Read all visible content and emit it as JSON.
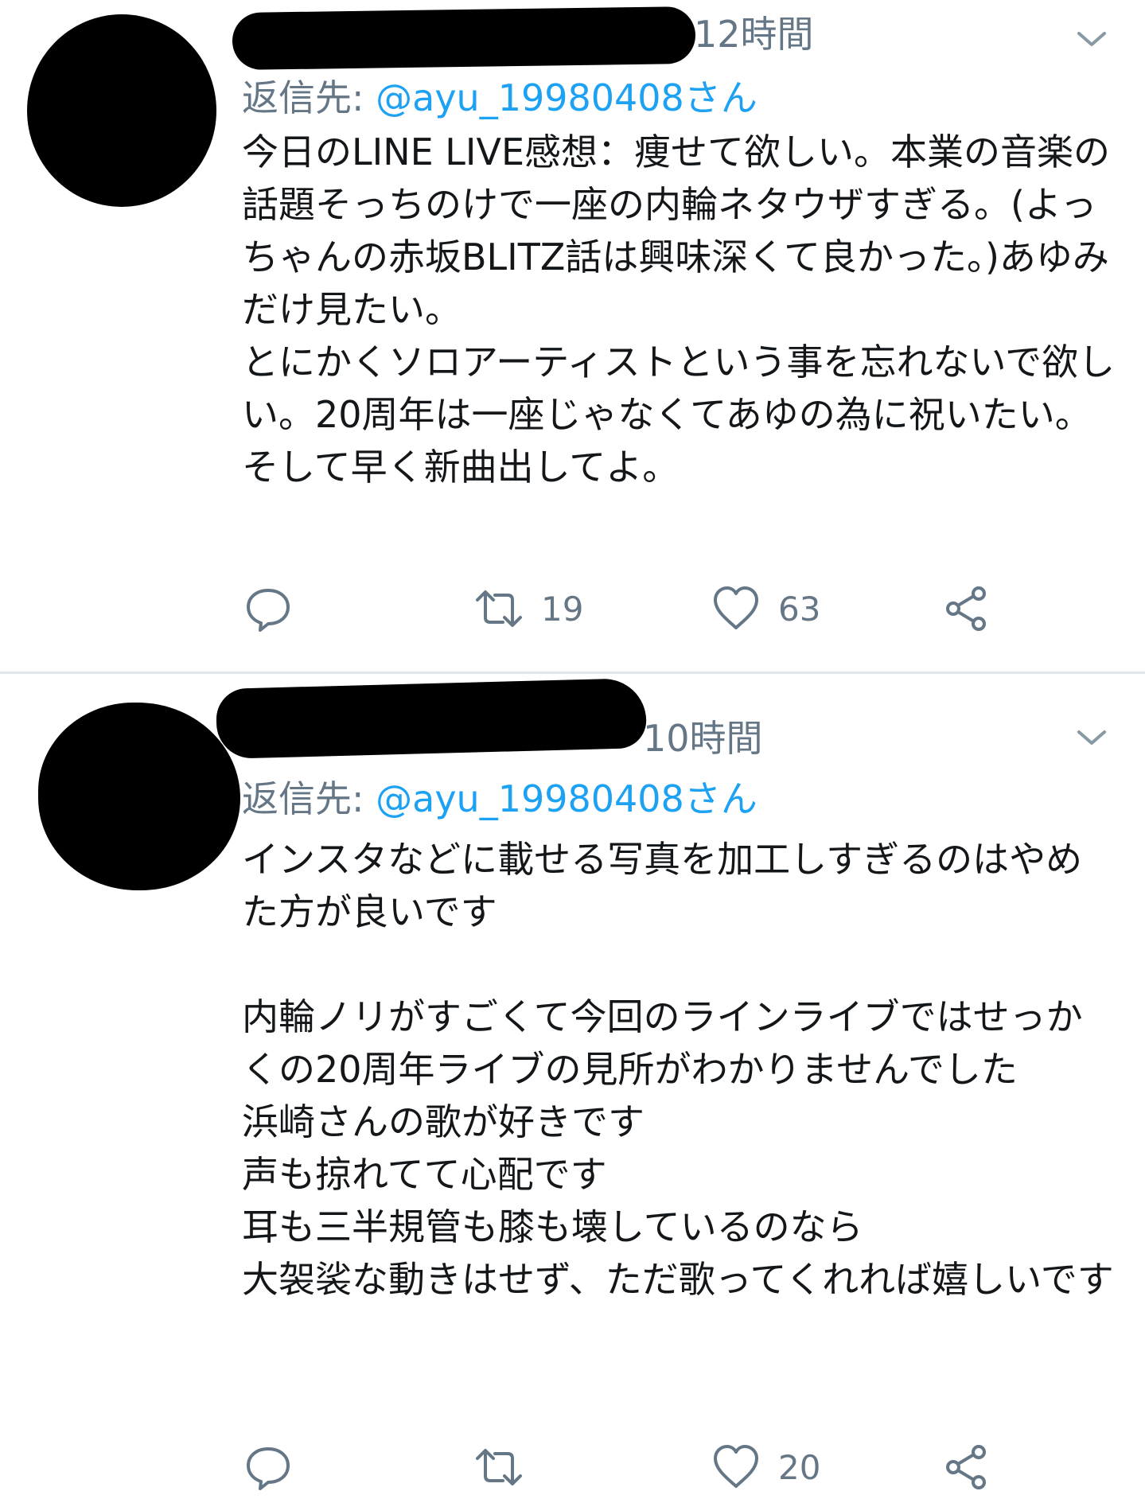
{
  "tweets": [
    {
      "time": "12時間",
      "reply_label": "返信先: ",
      "reply_handle": "@ayu_19980408さん",
      "body": "今日のLINE LIVE感想：痩せて欲しい。本業の音楽の話題そっちのけで一座の内輪ネタウザすぎる。(よっちゃんの赤坂BLITZ話は興味深くて良かった。)あゆみだけ見たい。\nとにかくソロアーティストという事を忘れないで欲しい。20周年は一座じゃなくてあゆの為に祝いたい。\nそして早く新曲出してよ。",
      "retweets": "19",
      "likes": "63"
    },
    {
      "time": "10時間",
      "reply_label": "返信先: ",
      "reply_handle": "@ayu_19980408さん",
      "body": "インスタなどに載せる写真を加工しすぎるのはやめた方が良いです\n\n内輪ノリがすごくて今回のラインライブではせっかくの20周年ライブの見所がわかりませんでした\n浜崎さんの歌が好きです\n声も掠れてて心配です\n耳も三半規管も膝も壊しているのなら\n大袈裟な動きはせず、ただ歌ってくれれば嬉しいです",
      "retweets": "",
      "likes": "20"
    }
  ],
  "icons": {
    "menu": "chevron-down-icon",
    "reply": "reply-icon",
    "retweet": "retweet-icon",
    "like": "heart-icon",
    "share": "share-icon"
  },
  "colors": {
    "link": "#1da1f2",
    "secondary": "#657786",
    "text": "#14171a",
    "divider": "#e1e8ed"
  }
}
